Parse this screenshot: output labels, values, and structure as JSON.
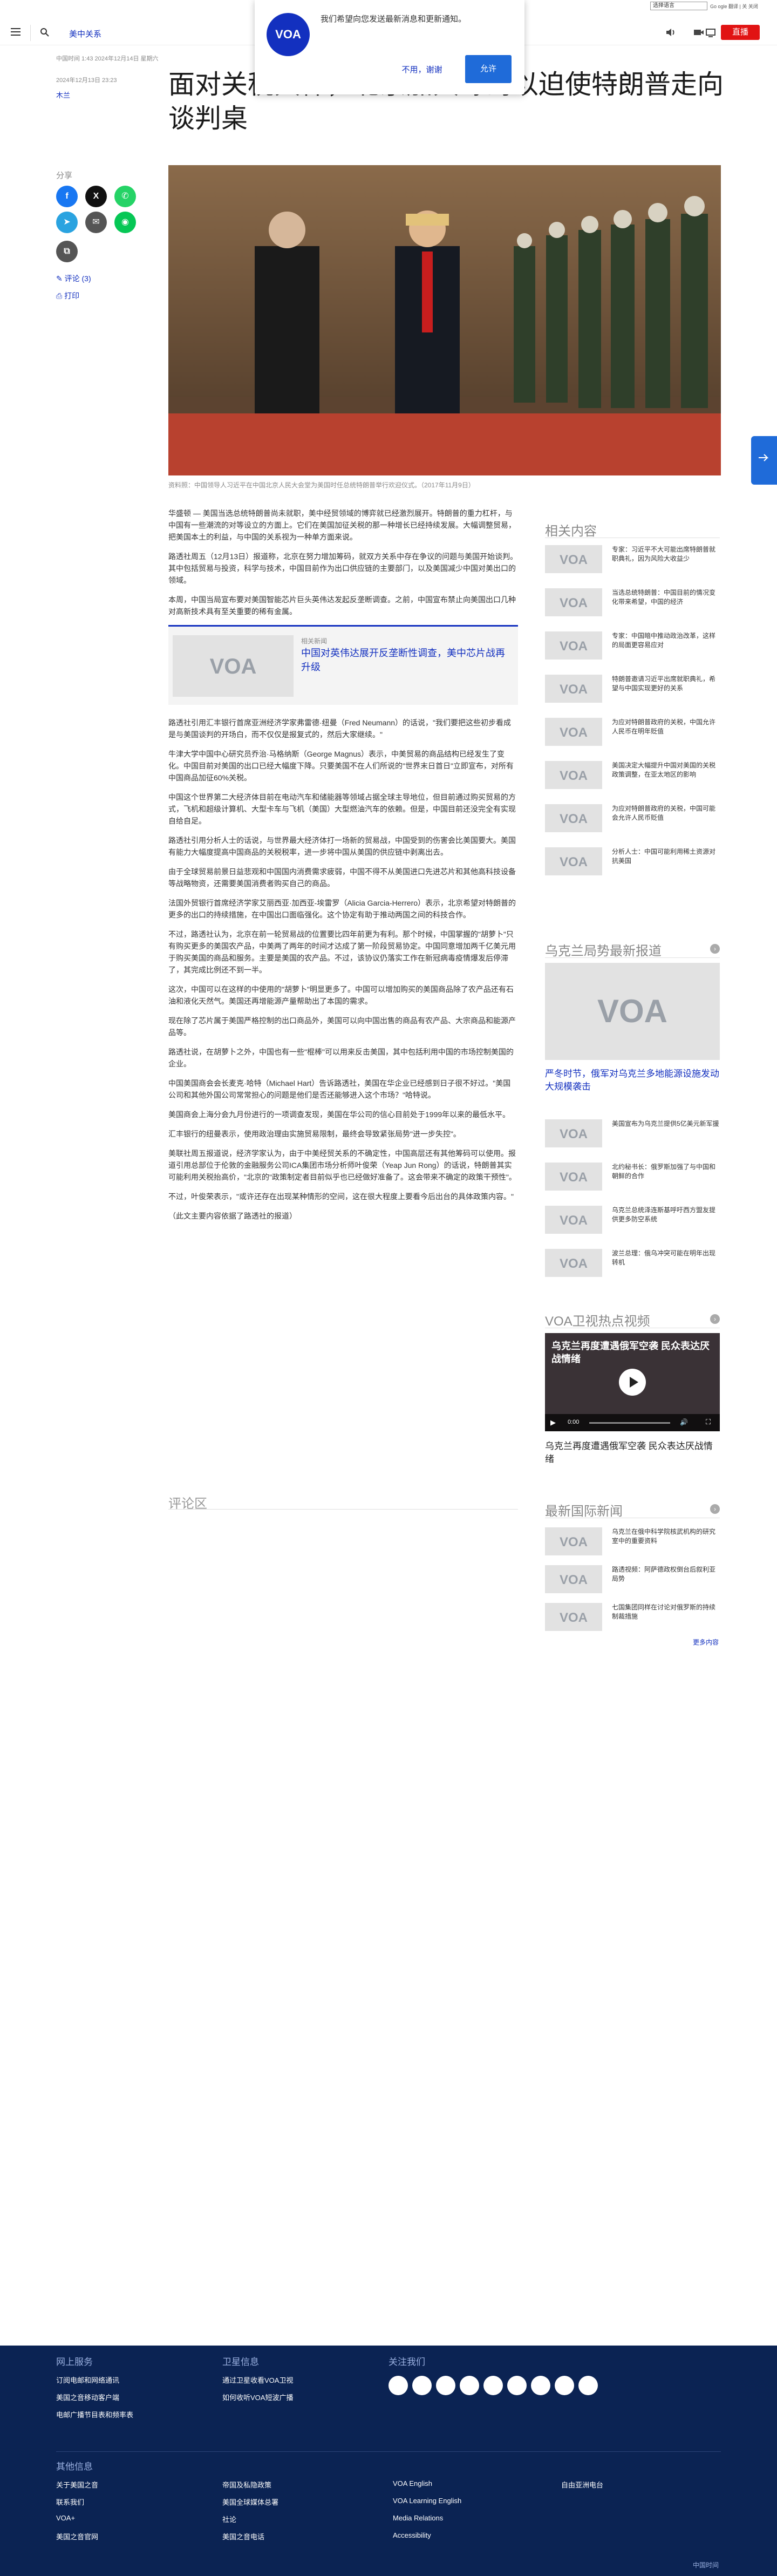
{
  "topbar": {
    "language_select": "选择语言",
    "links": "Go ogle 翻译 | 关 关闭"
  },
  "header": {
    "section": "美中关系",
    "live_label": "直播"
  },
  "notification": {
    "logo": "VOA",
    "message": "我们希望向您发送最新消息和更新通知。",
    "decline": "不用，谢谢",
    "accept": "允许"
  },
  "article": {
    "meta_top": "中国时间 1:43 2024年12月14日 星期六",
    "date": "2024年12月13日 23:23",
    "byline": "木兰",
    "headline": "面对关税大棒，北京加大筹码以迫使特朗普走向谈判桌",
    "share_label": "分享",
    "comments_link": "评论 (3)",
    "print_link": "打印",
    "hero_caption": "资料照：中国领导人习近平在中国北京人民大会堂为美国时任总统特朗普举行欢迎仪式。（2017年11月9日）",
    "hero_credit": "Reuters",
    "paragraphs": [
      "华盛顿 — 美国当选总统特朗普尚未就职，美中经贸领域的博弈就已经激烈展开。特朗普的重力杠杆，与中国有一些潮流的对等设立的方面上。它们在美国加征关税的那一种增长已经持续发展。大幅调整贸易，把美国本土的利益，与中国的关系视为一种单方面来说。",
      "路透社周五（12月13日）报道称，北京在努力增加筹码，就双方关系中存在争议的问题与美国开始谈判。其中包括贸易与投资，科学与技术，中国目前作为出口供应链的主要部门，以及美国减少中国对美出口的领域。",
      "本周，中国当局宣布要对美国智能芯片巨头英伟达发起反垄断调查。之前，中国宣布禁止向美国出口几种对高新技术具有至关重要的稀有金属。",
      "路透社引用汇丰银行首席亚洲经济学家弗雷德·纽曼（Fred Neumann）的话说，\"我们要把这些初步看成是与美国谈判的开场白，而不仅仅是报复式的，然后大家继续。\"",
      "牛津大学中国中心研究员乔治·马格纳斯（George Magnus）表示，中美贸易的商品结构已经发生了变化。中国目前对美国的出口已经大幅度下降。只要美国不在人们所说的\"世界末日首日\"立即宣布，对所有中国商品加征60%关税。",
      "中国这个世界第二大经济体目前在电动汽车和储能器等领域占据全球主导地位，但目前通过购买贸易的方式，飞机和超级计算机、大型卡车与飞机（美国）大型燃油汽车的依赖。但是，中国目前还没完全有实现自给自足。",
      "路透社引用分析人士的话说，与世界最大经济体打一场新的贸易战，中国受到的伤害会比美国要大。美国有能力大幅度提高中国商品的关税税率，进一步将中国从美国的供应链中剥离出去。",
      "由于全球贸易前景日益悲观和中国国内消费需求疲弱，中国不得不从美国进口先进芯片和其他高科技设备等战略物资，还需要美国消费者购买自己的商品。",
      "法国外贸银行首席经济学家艾丽西亚·加西亚-埃雷罗（Alicia Garcia-Herrero）表示，北京希望对特朗普的更多的出口的持续措施，在中国出口面临强化。这个协定有助于推动两国之间的科技合作。",
      "不过，路透社认为，北京在前一轮贸易战的位置要比四年前更为有利。那个时候，中国掌握的\"胡萝卜\"只有购买更多的美国农产品，中美两了两年的时间才达成了第一阶段贸易协定。中国同意增加两千亿美元用于购买美国的商品和服务。主要是美国的农产品。不过，该协议仍落实工作在新冠病毒疫情爆发后停滞了，其完成比例还不到一半。",
      "这次，中国可以在这样的中使用的\"胡萝卜\"明显更多了。中国可以增加购买的美国商品除了农产品还有石油和液化天然气。美国还再增能源产量帮助出了本国的需求。",
      "现在除了芯片属于美国严格控制的出口商品外，美国可以向中国出售的商品有农产品、大宗商品和能源产品等。",
      "路透社说，在胡萝卜之外，中国也有一些\"棍棒\"可以用来反击美国，其中包括利用中国的市场控制美国的企业。",
      "中国美国商会会长麦克·哈特（Michael Hart）告诉路透社，美国在华企业已经感到日子很不好过。\"美国公司和其他外国公司常常担心的问题是他们是否还能够进入这个市场？\"哈特说。",
      "美国商会上海分会九月份进行的一项调查发现，美国在华公司的信心目前处于1999年以来的最低水平。",
      "汇丰银行的纽曼表示，使用政治理由实施贸易限制，最终会导致紧张局势\"进一步失控\"。",
      "美联社周五报道说，经济学家认为，由于中美经贸关系的不确定性，中国高层还有其他筹码可以使用。报道引用总部位于伦敦的金融服务公司ICA集团市场分析师叶俊荣（Yeap Jun Rong）的话说，特朗普其实可能利用关税抬高价，\"北京的\"政策制定者目前似乎也已经做好准备了。这会带来不确定的政策干预性\"。",
      "不过，叶俊荣表示，\"或许还存在出现某种情形的空间，这在很大程度上要看今后出台的具体政策内容。\"",
      "（此文主要内容依据了路透社的报道）"
    ],
    "related": {
      "kicker": "相关新闻",
      "title": "中国对英伟达展开反垄断性调查，美中芯片战再升级"
    },
    "comments_heading": "评论区"
  },
  "sidebar": {
    "related_title": "相关内容",
    "related_items": [
      "专家：习近平不大可能出席特朗普就职典礼，因为风险大收益少",
      "当选总统特朗普：中国目前的情况变化带来希望，中国的经济",
      "专家：中国暗中推动政治改革，这样的局面更容易应对",
      "特朗普邀请习近平出席就职典礼，希望与中国实现更好的关系",
      "为应对特朗普政府的关税，中国允许人民币在明年贬值",
      "美国决定大幅提升中国对美国的关税政策调整，在亚太地区的影响",
      "为应对特朗普政府的关税，中国可能会允许人民币贬值",
      "分析人士：中国可能利用稀土资源对抗美国"
    ],
    "ukraine_title": "乌克兰局势最新报道",
    "ukraine_feature": "严冬时节，俄军对乌克兰多地能源设施发动大规模袭击",
    "ukraine_items": [
      "美国宣布为乌克兰提供5亿美元新军援",
      "北约秘书长：俄罗斯加强了与中国和朝鲜的合作",
      "乌克兰总统泽连斯基呼吁西方盟友提供更多防空系统",
      "波兰总理：俄乌冲突可能在明年出现转机"
    ],
    "video_title": "VOA卫视热点视频",
    "video_overlay": "乌克兰再度遭遇俄军空袭 民众表达厌战情绪",
    "video_time": "0:00",
    "video_caption": "乌克兰再度遭遇俄军空袭 民众表达厌战情绪",
    "intl_title": "最新国际新闻",
    "intl_items": [
      "乌克兰在俄中科学院核武机构的研究室中的重要资料",
      "路透视频：阿萨德政权倒台后叙利亚局势",
      "七国集团同样在讨论对俄罗斯的持续制裁措施"
    ],
    "more_link": "更多内容"
  },
  "footer": {
    "col1_title": "网上服务",
    "col1_links": [
      "订阅电邮和网络通讯",
      "美国之音移动客户端",
      "电邮广播节目表和频率表"
    ],
    "col2_title": "卫星信息",
    "col2_links": [
      "通过卫星收看VOA卫视",
      "如何收听VOA短波广播"
    ],
    "col3_title": "关注我们",
    "col4_title": "其他信息",
    "col4_links": [
      "关于美国之音",
      "联系我们",
      "VOA+",
      "美国之音官网"
    ],
    "col5_links": [
      "帝国及私隐政策",
      "美国全球媒体总署",
      "社论",
      "美国之音电话"
    ],
    "col6_links": [
      "VOA English",
      "VOA Learning English",
      "Media Relations",
      "Accessibility"
    ],
    "col7_links": [
      "自由亚洲电台"
    ],
    "bottom": "中国时间"
  }
}
